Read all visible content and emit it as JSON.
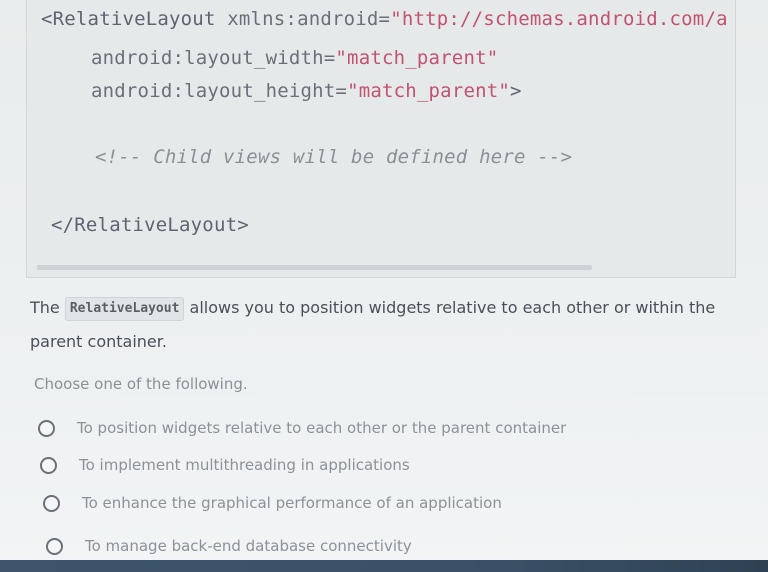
{
  "code": {
    "line1_tag": "<RelativeLayout",
    "line1_attr": " xmlns:android=",
    "line1_val": "\"http://schemas.android.com/a",
    "line2_attr": "android:layout_width=",
    "line2_val": "\"match_parent\"",
    "line3_attr": "android:layout_height=",
    "line3_val": "\"match_parent\"",
    "line3_end": ">",
    "comment": "<!-- Child views will be defined here -->",
    "closing_tag": "</RelativeLayout>"
  },
  "question": {
    "prefix": "The ",
    "inline_code": "RelativeLayout",
    "suffix": " allows you to position widgets relative to each other or within the parent container."
  },
  "instruction": "Choose one of the following.",
  "options": [
    {
      "label": "To position widgets relative to each other or the parent container"
    },
    {
      "label": "To implement multithreading in applications"
    },
    {
      "label": "To enhance the graphical performance of an application"
    },
    {
      "label": "To manage back-end database connectivity"
    }
  ]
}
